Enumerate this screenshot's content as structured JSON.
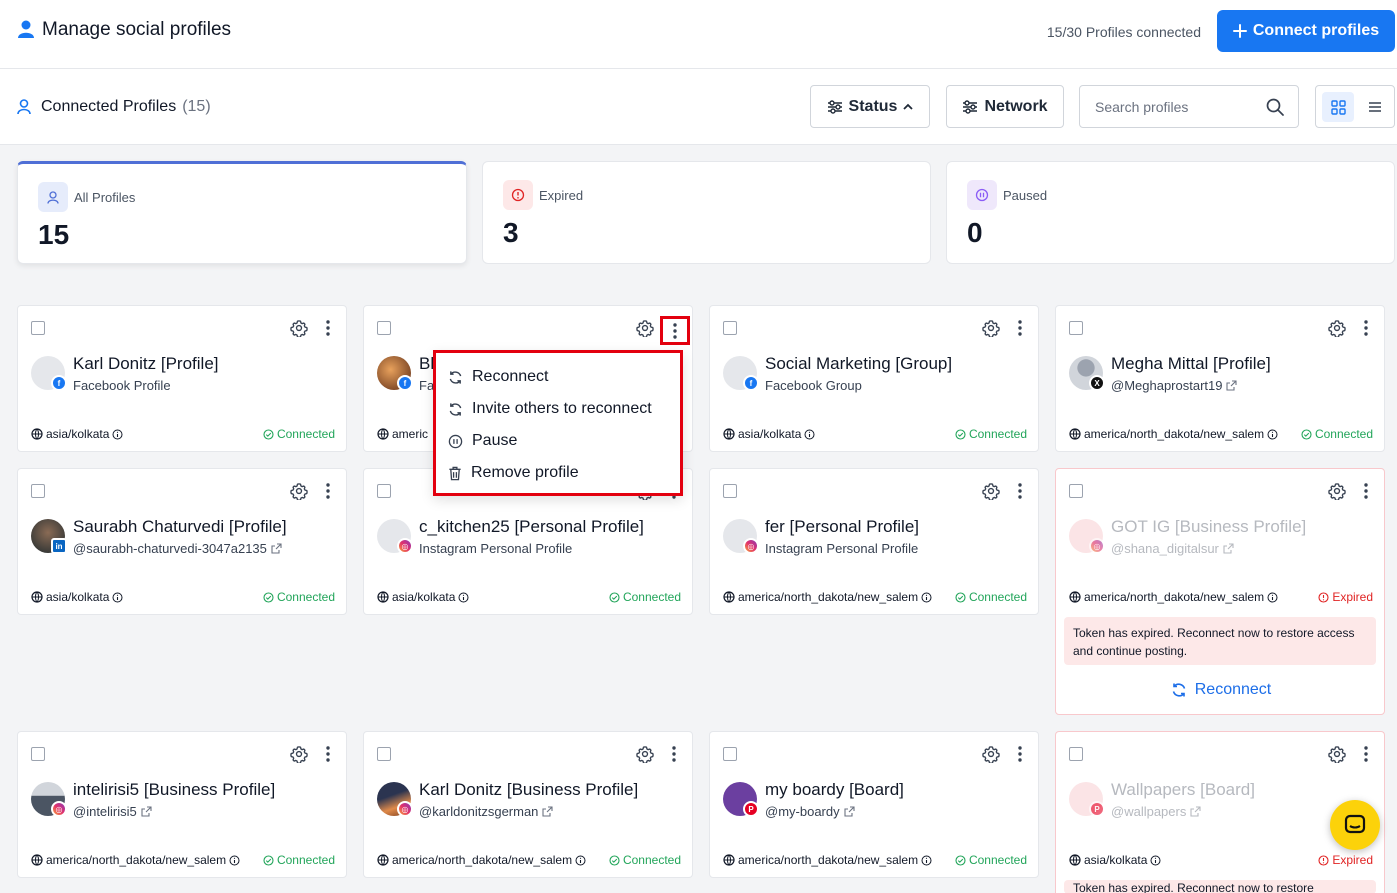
{
  "header": {
    "title": "Manage social profiles",
    "count_text": "15/30 Profiles connected",
    "connect_button": "Connect profiles"
  },
  "toolbar": {
    "section_title": "Connected Profiles",
    "section_count": "(15)",
    "status_filter": "Status",
    "network_filter": "Network",
    "search_placeholder": "Search profiles"
  },
  "stats": [
    {
      "label": "All Profiles",
      "value": "15"
    },
    {
      "label": "Expired",
      "value": "3"
    },
    {
      "label": "Paused",
      "value": "0"
    }
  ],
  "profiles": [
    {
      "name": "Karl Donitz [Profile]",
      "subtitle": "Facebook Profile",
      "timezone": "asia/kolkata",
      "status": "Connected",
      "network": "facebook"
    },
    {
      "name": "Bl",
      "subtitle": "Fa",
      "timezone": "americ",
      "status": "",
      "network": "facebook"
    },
    {
      "name": "Social Marketing [Group]",
      "subtitle": "Facebook Group",
      "timezone": "asia/kolkata",
      "status": "Connected",
      "network": "facebook"
    },
    {
      "name": "Megha Mittal [Profile]",
      "subtitle": "@Meghaprostart19",
      "timezone": "america/north_dakota/new_salem",
      "status": "Connected",
      "network": "x"
    },
    {
      "name": "Saurabh Chaturvedi [Profile]",
      "subtitle": "@saurabh-chaturvedi-3047a2135",
      "timezone": "asia/kolkata",
      "status": "Connected",
      "network": "linkedin"
    },
    {
      "name": "c_kitchen25 [Personal Profile]",
      "subtitle": "Instagram Personal Profile",
      "timezone": "asia/kolkata",
      "status": "Connected",
      "network": "instagram"
    },
    {
      "name": "fer [Personal Profile]",
      "subtitle": "Instagram Personal Profile",
      "timezone": "america/north_dakota/new_salem",
      "status": "Connected",
      "network": "instagram"
    },
    {
      "name": "GOT IG [Business Profile]",
      "subtitle": "@shana_digitalsur",
      "timezone": "america/north_dakota/new_salem",
      "status": "Expired",
      "network": "instagram",
      "notice": "Token has expired. Reconnect now to restore access and continue posting.",
      "action": "Reconnect"
    },
    {
      "name": "intelirisi5 [Business Profile]",
      "subtitle": "@intelirisi5",
      "timezone": "america/north_dakota/new_salem",
      "status": "Connected",
      "network": "instagram"
    },
    {
      "name": "Karl Donitz [Business Profile]",
      "subtitle": "@karldonitzsgerman",
      "timezone": "america/north_dakota/new_salem",
      "status": "Connected",
      "network": "instagram"
    },
    {
      "name": "my boardy [Board]",
      "subtitle": "@my-boardy",
      "timezone": "america/north_dakota/new_salem",
      "status": "Connected",
      "network": "pinterest"
    },
    {
      "name": "Wallpapers [Board]",
      "subtitle": "@wallpapers",
      "timezone": "asia/kolkata",
      "status": "Expired",
      "network": "pinterest",
      "notice": "Token has expired. Reconnect now to restore"
    }
  ],
  "menu": {
    "items": [
      {
        "label": "Reconnect",
        "icon": "refresh-icon"
      },
      {
        "label": "Invite others to reconnect",
        "icon": "refresh-icon"
      },
      {
        "label": "Pause",
        "icon": "pause-icon"
      },
      {
        "label": "Remove profile",
        "icon": "trash-icon"
      }
    ]
  },
  "colors": {
    "primary": "#1877f2",
    "connected": "#22a55a",
    "expired": "#e02424",
    "highlight": "#e3000f"
  }
}
